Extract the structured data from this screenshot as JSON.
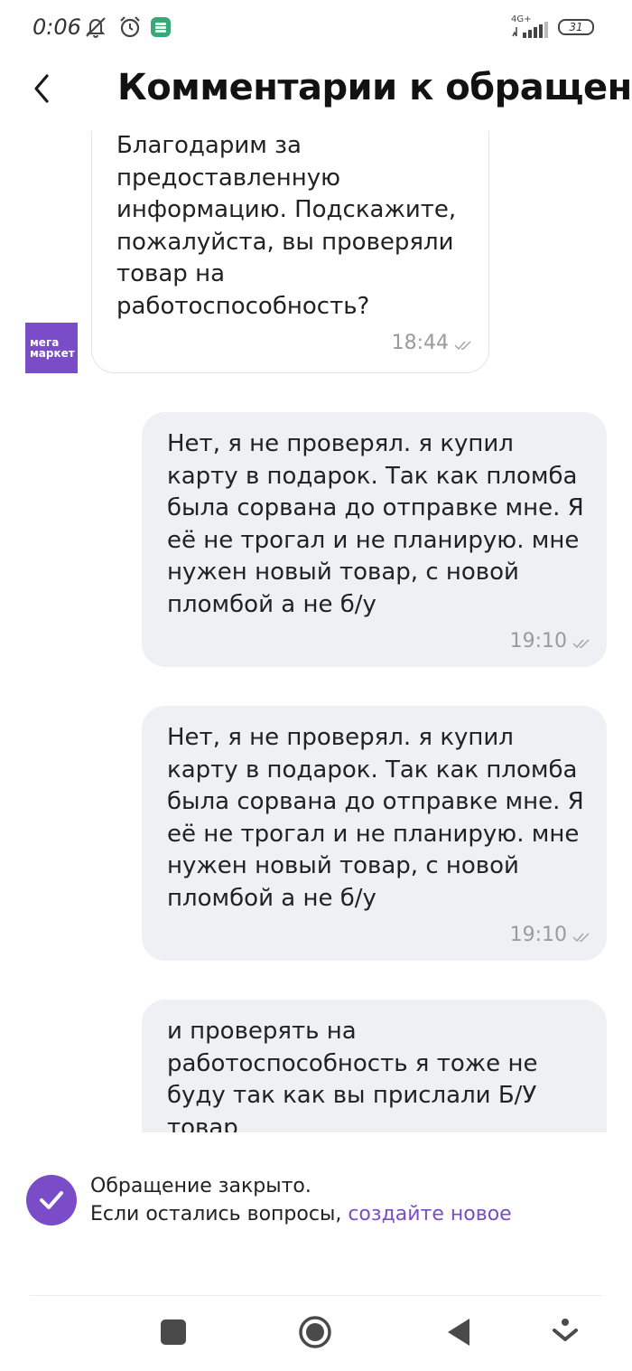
{
  "status_bar": {
    "time": "0:06",
    "network": "4G+",
    "battery": "31",
    "icons": [
      "mute-icon",
      "alarm-icon",
      "app-notification-icon",
      "signal-icon",
      "battery-icon"
    ]
  },
  "header": {
    "title": "Комментарии к обращен...",
    "back_icon": "chevron-left-icon"
  },
  "support_avatar": {
    "brand_line1": "мега",
    "brand_line2": "маркет",
    "color": "#7b4cc7"
  },
  "messages": [
    {
      "from": "support",
      "text": "Благодарим за предоставленную информацию. Подскажите, пожалуйста, вы проверяли товар на работоспособность?",
      "time": "18:44"
    },
    {
      "from": "user",
      "text": "Нет, я не проверял. я купил карту в подарок. Так как пломба была сорвана до отправке мне. Я её не трогал и не планирую. мне нужен новый товар, с новой пломбой а не б/у",
      "time": "19:10"
    },
    {
      "from": "user",
      "text": "Нет, я не проверял. я купил карту в подарок. Так как пломба была сорвана до отправке мне. Я её не трогал и не планирую. мне нужен новый товар, с новой пломбой а не б/у",
      "time": "19:10"
    },
    {
      "from": "user",
      "text": "и проверять на работоспособность я тоже не буду так как вы прислали Б/У товар",
      "time": ""
    }
  ],
  "notice": {
    "line1": "Обращение закрыто.",
    "line2_prefix": "Если остались вопросы, ",
    "link": "создайте новое"
  },
  "colors": {
    "accent": "#7b4cc7",
    "bubble_out": "#eef0f3",
    "bubble_in_border": "#e4e4e8",
    "time_gray": "#9a9a9f"
  },
  "nav_bar": {
    "icons": [
      "recent-apps-icon",
      "home-icon",
      "back-triangle-icon",
      "gesture-icon"
    ]
  }
}
